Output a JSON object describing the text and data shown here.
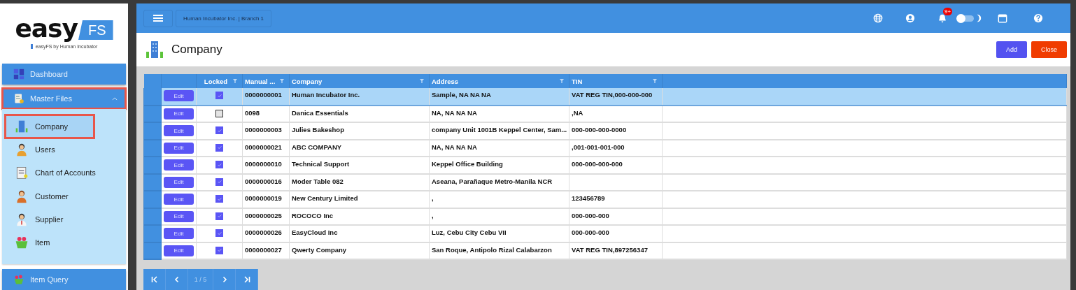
{
  "sidebar": {
    "logo_word": "easy",
    "logo_badge": "FS",
    "tagline": "easyFS by Human Incubator",
    "menu": [
      {
        "label": "Dashboard"
      },
      {
        "label": "Master Files",
        "expanded": true,
        "highlighted": true,
        "children": [
          {
            "label": "Company",
            "selected": true,
            "highlighted": true
          },
          {
            "label": "Users",
            "selected": false,
            "highlighted": false
          },
          {
            "label": "Chart of Accounts",
            "selected": false,
            "highlighted": false
          },
          {
            "label": "Customer",
            "selected": false,
            "highlighted": false
          },
          {
            "label": "Supplier",
            "selected": false,
            "highlighted": false
          },
          {
            "label": "Item",
            "selected": false,
            "highlighted": false
          }
        ]
      },
      {
        "label": "Item Query"
      }
    ]
  },
  "topbar": {
    "branch": "Human Incubator Inc. | Branch 1",
    "notification_count": "9+",
    "dark_mode": false
  },
  "page": {
    "title": "Company",
    "buttons": [
      {
        "label": "Add",
        "kind": "primary"
      },
      {
        "label": "Close",
        "kind": "danger"
      }
    ]
  },
  "table": {
    "columns": [
      "Locked",
      "Manual ...",
      "Company",
      "Address",
      "TIN"
    ],
    "rows": [
      {
        "selected": true,
        "edit": "Edit",
        "locked": true,
        "manual": "0000000001",
        "company": "Human Incubator Inc.",
        "address": "Sample, NA NA NA",
        "tin": "VAT REG TIN,000-000-000"
      },
      {
        "selected": false,
        "edit": "Edit",
        "locked": false,
        "manual": "0098",
        "company": "Danica Essentials",
        "address": "NA, NA NA NA",
        "tin": ",NA"
      },
      {
        "selected": false,
        "edit": "Edit",
        "locked": true,
        "manual": "0000000003",
        "company": "Julies Bakeshop",
        "address": "company Unit 1001B Keppel Center, Sam...",
        "tin": "000-000-000-0000"
      },
      {
        "selected": false,
        "edit": "Edit",
        "locked": true,
        "manual": "0000000021",
        "company": "ABC COMPANY",
        "address": "NA, NA NA NA",
        "tin": ",001-001-001-000"
      },
      {
        "selected": false,
        "edit": "Edit",
        "locked": true,
        "manual": "0000000010",
        "company": "Technical Support",
        "address": "Keppel Office Building",
        "tin": "000-000-000-000"
      },
      {
        "selected": false,
        "edit": "Edit",
        "locked": true,
        "manual": "0000000016",
        "company": "Moder Table 082",
        "address": "Aseana, Parañaque Metro-Manila NCR"
      },
      {
        "selected": false,
        "edit": "Edit",
        "locked": true,
        "manual": "0000000019",
        "company": "New Century Limited",
        "address": ",",
        "tin": "123456789"
      },
      {
        "selected": false,
        "edit": "Edit",
        "locked": true,
        "manual": "0000000025",
        "company": "ROCOCO Inc",
        "address": ",",
        "tin": "000-000-000"
      },
      {
        "selected": false,
        "edit": "Edit",
        "locked": true,
        "manual": "0000000026",
        "company": "EasyCloud Inc",
        "address": "Luz, Cebu City Cebu VII",
        "tin": "000-000-000"
      },
      {
        "selected": false,
        "edit": "Edit",
        "locked": true,
        "manual": "0000000027",
        "company": "Qwerty Company",
        "address": "San Roque, Antipolo Rizal Calabarzon",
        "tin": "VAT REG TIN,897256347"
      }
    ]
  },
  "pagination": {
    "page": "1 / 5"
  }
}
